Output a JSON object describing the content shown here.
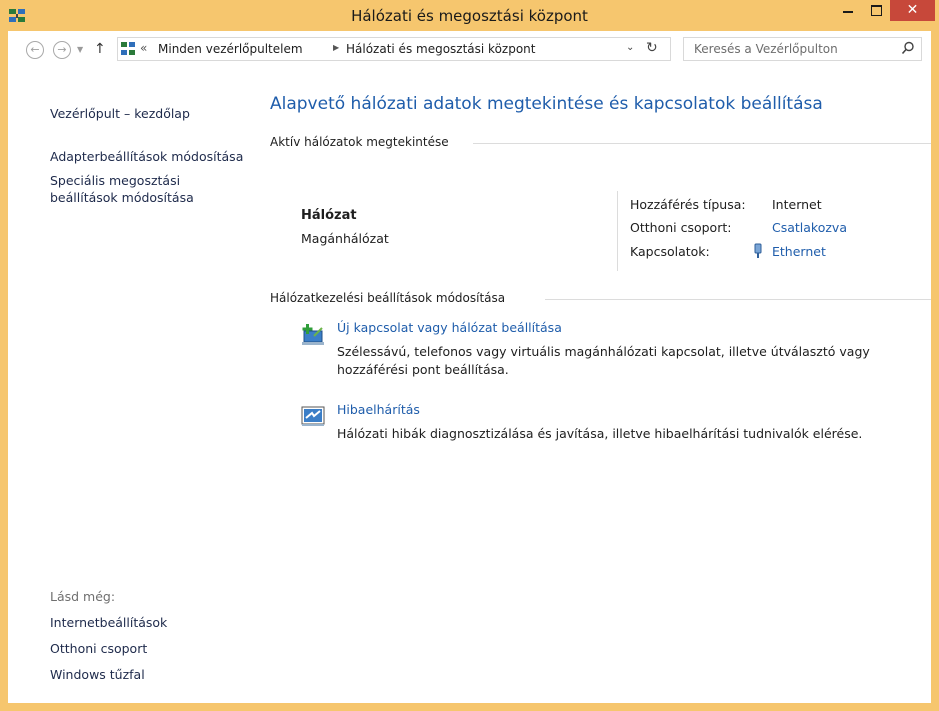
{
  "window": {
    "title": "Hálózati és megosztási központ",
    "close_glyph": "✕"
  },
  "nav": {
    "back_glyph": "←",
    "forward_glyph": "→",
    "dropdown_glyph": "▼",
    "up_glyph": "↑"
  },
  "address": {
    "chevron": "«",
    "crumbs": [
      "Minden vezérlőpultelem",
      "Hálózati és megosztási központ"
    ],
    "separator": "▶",
    "dropdown_glyph": "⌄",
    "refresh_glyph": "↻"
  },
  "search": {
    "placeholder": "Keresés a Vezérlőpulton"
  },
  "sidebar": {
    "home": "Vezérlőpult – kezdőlap",
    "adapter": "Adapterbeállítások módosítása",
    "sharing_line1": "Speciális megosztási",
    "sharing_line2": "beállítások módosítása",
    "see_also": "Lásd még:",
    "links": [
      "Internetbeállítások",
      "Otthoni csoport",
      "Windows tűzfal"
    ]
  },
  "main": {
    "title": "Alapvető hálózati adatok megtekintése és kapcsolatok beállítása",
    "active_header": "Aktív hálózatok megtekintése",
    "network_name": "Hálózat",
    "network_type": "Magánhálózat",
    "access_label": "Hozzáférés típusa:",
    "access_value": "Internet",
    "homegroup_label": "Otthoni csoport:",
    "homegroup_value": "Csatlakozva",
    "connections_label": "Kapcsolatok:",
    "connections_value": "Ethernet",
    "change_header": "Hálózatkezelési beállítások módosítása",
    "tasks": [
      {
        "link": "Új kapcsolat vagy hálózat beállítása",
        "desc_line1": "Szélessávú, telefonos vagy virtuális magánhálózati kapcsolat, illetve útválasztó vagy",
        "desc_line2": "hozzáférési pont beállítása."
      },
      {
        "link": "Hibaelhárítás",
        "desc_line1": "Hálózati hibák diagnosztizálása és javítása, illetve hibaelhárítási tudnivalók elérése."
      }
    ]
  },
  "colors": {
    "frame": "#f6c66e",
    "link_blue": "#1f5dab",
    "close_red": "#c7483a",
    "nav_text": "#1e2a4b"
  },
  "icons": [
    "network-center-icon",
    "back-arrow-icon",
    "forward-arrow-icon",
    "up-arrow-icon",
    "refresh-icon",
    "search-icon",
    "ethernet-icon",
    "new-connection-icon",
    "troubleshoot-icon"
  ]
}
